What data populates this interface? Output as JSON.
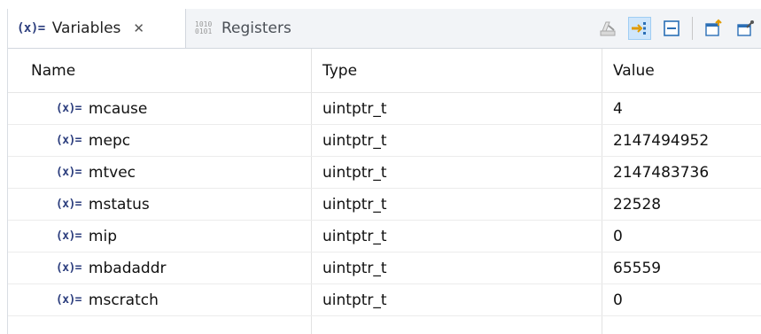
{
  "tabs": [
    {
      "label": "Variables",
      "icon": "variables-icon",
      "glyph": "(x)=",
      "close": "✕"
    },
    {
      "label": "Registers",
      "icon": "registers-icon",
      "glyph_top": "1010",
      "glyph_bottom": "0101"
    }
  ],
  "toolbar": {
    "buttons": [
      {
        "icon": "clear-icon"
      },
      {
        "icon": "show-type-names-icon",
        "pressed": true
      },
      {
        "icon": "collapse-all-icon"
      },
      {
        "icon": "open-new-view-icon"
      },
      {
        "icon": "pin-view-icon"
      }
    ]
  },
  "table": {
    "columns": [
      "Name",
      "Type",
      "Value"
    ],
    "row_icon": "(x)=",
    "rows": [
      {
        "name": "mcause",
        "type": "uintptr_t",
        "value": "4"
      },
      {
        "name": "mepc",
        "type": "uintptr_t",
        "value": "2147494952"
      },
      {
        "name": "mtvec",
        "type": "uintptr_t",
        "value": "2147483736"
      },
      {
        "name": "mstatus",
        "type": "uintptr_t",
        "value": "22528"
      },
      {
        "name": "mip",
        "type": "uintptr_t",
        "value": "0"
      },
      {
        "name": "mbadaddr",
        "type": "uintptr_t",
        "value": "65559"
      },
      {
        "name": "mscratch",
        "type": "uintptr_t",
        "value": "0"
      }
    ]
  },
  "colors": {
    "icon_blue": "#2b3d7d",
    "pressed_bg": "#cfe6fb",
    "tabbar_bg": "#f2f4f7"
  }
}
